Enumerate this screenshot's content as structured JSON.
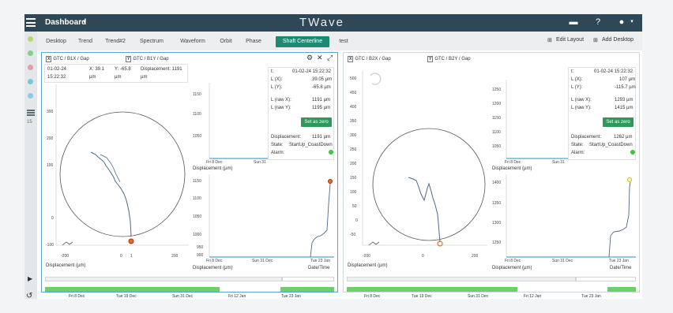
{
  "topbar": {
    "dashboard_label": "Dashboard",
    "logo": "TWave",
    "icons": [
      "menu-icon",
      "chat-icon",
      "help-icon",
      "account-icon"
    ]
  },
  "sidebar": {
    "count_label": "15"
  },
  "tabs": [
    {
      "label": "Desktop"
    },
    {
      "label": "Trend"
    },
    {
      "label": "Trend#2"
    },
    {
      "label": "Spectrum"
    },
    {
      "label": "Waveform"
    },
    {
      "label": "Orbit"
    },
    {
      "label": "Phase"
    },
    {
      "label": "Shaft Centerline"
    },
    {
      "label": "test"
    }
  ],
  "active_tab": "Shaft Centerline",
  "toolbar": {
    "edit_layout": "Edit Layout",
    "add_desktop": "Add Desktop"
  },
  "panel1": {
    "title_x": "GTC / B1X / Gap",
    "title_y": "GTC / B1Y / Gap",
    "cursor": {
      "date": "01-02-24",
      "time": "15:22:32",
      "x": "X: 39.1",
      "x_unit": "µm",
      "y": "Y: -65.8",
      "y_unit": "µm",
      "disp": "Displacement: 1191",
      "disp_unit": "µm"
    },
    "info": {
      "t_label": "t:",
      "t_value": "01-02-24 15:22:32",
      "lx_label": "L (X):",
      "lx_value": "39.05 µm",
      "ly_label": "L (Y):",
      "ly_value": "-65.8 µm",
      "rawx_label": "L (raw X):",
      "rawx_value": "1191 µm",
      "rawy_label": "L (raw Y):",
      "rawy_value": "1195 µm",
      "zero_btn": "Set as zero",
      "disp_label": "Displacement:",
      "disp_value": "1191 µm",
      "state_label": "State:",
      "state_value": "StartUp_CoastDown",
      "alarm_label": "Alarm:"
    },
    "orbit_xticks": [
      "-200",
      "0",
      "1",
      "200"
    ],
    "orbit_yticks": [
      "300",
      "200",
      "100",
      "0",
      "-100"
    ],
    "orbit_xlabel": "Displacement (µm)",
    "trend_top_yticks": [
      "1150",
      "1100",
      "1050"
    ],
    "trend_top_xticks": [
      "Fri 8 Dec",
      "Sun 31"
    ],
    "trend_bottom_ylabel": "Displacement (µm)",
    "trend_bottom_yticks": [
      "1150",
      "1100",
      "1050",
      "1000",
      "950",
      "900"
    ],
    "trend_bottom_xticks": [
      "Fri 8 Dec",
      "Sun 31 Dec",
      "Tue 23 Jan"
    ],
    "trend_xlabel": "Displacement (µm)",
    "date_label": "Date/Time",
    "timeline_ticks": [
      "Fri 8 Dec",
      "Tue 19 Dec",
      "Sun 31 Dec",
      "Fri 12 Jan",
      "Tue 23 Jan"
    ]
  },
  "panel2": {
    "title_x": "GTC / B2X / Gap",
    "title_y": "GTC / B2Y / Gap",
    "info": {
      "t_label": "t:",
      "t_value": "01-02-24 15:22:32",
      "lx_label": "L (X):",
      "lx_value": "107 µm",
      "ly_label": "L (Y):",
      "ly_value": "-115.7 µm",
      "rawx_label": "L (raw X):",
      "rawx_value": "1293 µm",
      "rawy_label": "L (raw Y):",
      "rawy_value": "1415 µm",
      "zero_btn": "Set as zero",
      "disp_label": "Displacement:",
      "disp_value": "1262 µm",
      "state_label": "State:",
      "state_value": "StartUp_CoastDown",
      "alarm_label": "Alarm:"
    },
    "orbit_xticks": [
      "-200",
      "0",
      "200"
    ],
    "orbit_yticks": [
      "500",
      "450",
      "400",
      "350",
      "300",
      "250",
      "200",
      "150",
      "100",
      "50",
      "0",
      "-50"
    ],
    "orbit_xlabel": "Displacement (µm)",
    "trend_top_yticks": [
      "1250",
      "1200",
      "1150",
      "1100",
      "1050"
    ],
    "trend_top_xticks": [
      "Fri 8 Dec",
      "Sun 31"
    ],
    "trend_bottom_ylabel": "Displacement (µm)",
    "trend_bottom_yticks": [
      "1400",
      "1350",
      "1300",
      "1250"
    ],
    "trend_bottom_xticks": [
      "Fri 8 Dec",
      "Sun 31 Dec",
      "Tue 23 Jan"
    ],
    "trend_xlabel": "Displacement (µm)",
    "date_label": "Date/Time",
    "timeline_ticks": [
      "Fri 8 Dec",
      "Tue 19 Dec",
      "Sun 31 Dec",
      "Fri 12 Jan",
      "Tue 23 Jan"
    ]
  },
  "colors": {
    "topbar": "#2f4858",
    "accent": "#1e8a72",
    "timeline": "#6fcf6b",
    "button": "#2b9a5a",
    "trace": "#4a6a8a",
    "marker": "#e07020",
    "alarm": "#44c144"
  }
}
